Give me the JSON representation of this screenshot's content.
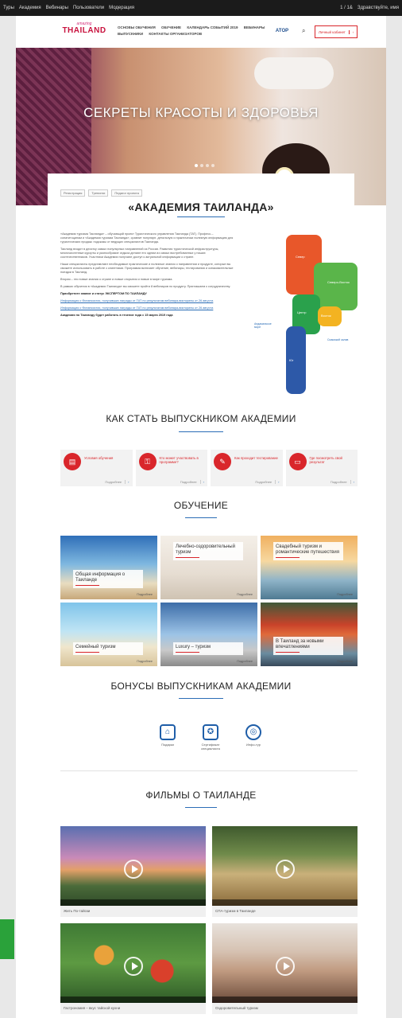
{
  "topbar": {
    "left": [
      "Туры",
      "Академия",
      "Вебинары",
      "Пользователи",
      "Модерация"
    ],
    "right": [
      "1 / 1&",
      "Здравствуйте, имя"
    ]
  },
  "header": {
    "logo_top": "amazing",
    "logo_main": "THAILAND",
    "nav": [
      "ОСНОВЫ ОБУЧЕНИЯ",
      "ОБУЧЕНИЕ",
      "КАЛЕНДАРЬ СОБЫТИЙ 2019",
      "ВЕБИНАРЫ",
      "ВЫПУСКНИКИ",
      "КОНТАКТЫ ОРГАНИЗАТОРОВ"
    ],
    "atop": "АТОР",
    "login": "Личный кабинет"
  },
  "hero": {
    "title": "СЕКРЕТЫ КРАСОТЫ И ЗДОРОВЬЯ"
  },
  "crumbs": [
    "Регистрация",
    "Тренинги",
    "Педагог проекта"
  ],
  "academy": {
    "title": "«АКАДЕМИЯ ТАИЛАНДА»",
    "paragraphs": [
      "«Академия туризма Таиланда» – обучающий проект Туристического управления Таиланда (TAT). Професс.– сонатитоцинам и «Академия туризма Таиланда», сравнит популярн. детальную и практически полезную информацию для туристических продаж: подсказы от ведущих специалистов Таиланда.",
      "Таиланд входит в десятку самых популярных направлений из России. Развития туристической инфраструктуры, многочисленные курорты и разнообразие отдыха делают его одним из самых востребованных у наших соотечественников. Участники Академии получают доступ к актуальной информации о стране.",
      "Наши специалисты представляют необходимые практические и полезные знания о направлении и продукте, которые вы сможете использовать в работе с клиентами. Программа включает обучение, вебинары, тестирования и ознакомительные поездки в Таиланд.",
      "Вторая – это новые знания о стране и новые открытия и новые в мире туризма.",
      "В рамках обучения в «Академии Таиланда» вы сможете пройти 8 вебинаров по продукту. Приглашаем к сотрудничеству."
    ],
    "expert": "Приобретите звание и статус ЭКСПЕРТОМ ПО ТАИЛАНДУ",
    "link1": "Информация о Финансистах, получивших награды от ТАТ по результатам вебинара-викторины от 26 августа",
    "link2": "Информация о Финансистах, получивших награды от ТАТ по результатам вебинара-викторины от 26 августа",
    "footer": "Академия по Таиланду будет работать в течение года с 15 марта 2019 года"
  },
  "map": {
    "labels": [
      "Север",
      "Северо-Восток",
      "Центр",
      "Восток",
      "Юг",
      "Андаманское море",
      "Сиамский залив"
    ]
  },
  "howto": {
    "title": "КАК СТАТЬ ВЫПУСКНИКОМ АКАДЕМИИ",
    "steps": [
      {
        "label": "Условия обучения",
        "more": "Подробнее"
      },
      {
        "label": "Кто может участвовать в программе?",
        "more": "Подробнее"
      },
      {
        "label": "Как проходит тестирование",
        "more": "Подробнее"
      },
      {
        "label": "Где посмотреть свой результат",
        "more": "Подробнее"
      }
    ]
  },
  "learning": {
    "title": "ОБУЧЕНИЕ",
    "tiles": [
      {
        "label": "Общая информация о Таиланде",
        "more": "Подробнее"
      },
      {
        "label": "Лечебно-оздоровительный туризм",
        "more": "Подробнее"
      },
      {
        "label": "Свадебный туризм и романтические путешествия",
        "more": "Подробнее"
      },
      {
        "label": "Семейный туризм",
        "more": "Подробнее"
      },
      {
        "label": "Luxury – туризм",
        "more": "Подробнее"
      },
      {
        "label": "В Таиланд за новыми впечатлениями",
        "more": "Подробнее"
      }
    ]
  },
  "bonus": {
    "title": "БОНУСЫ ВЫПУСКНИКАМ АКАДЕМИИ",
    "items": [
      {
        "label": "Подарки"
      },
      {
        "label": "Сертификат специалиста"
      },
      {
        "label": "Инфо-тур"
      }
    ]
  },
  "films": {
    "title": "ФИЛЬМЫ О ТАИЛАНДЕ",
    "items": [
      {
        "caption": "Жить По-тайски"
      },
      {
        "caption": "СПА-туризм в Таиланде"
      },
      {
        "caption": "Гастрономия – вкус тайской кухни"
      },
      {
        "caption": "Оздоровительный туризм"
      }
    ]
  },
  "colors": {
    "accent": "#d9262b",
    "blue": "#2b6db6"
  }
}
